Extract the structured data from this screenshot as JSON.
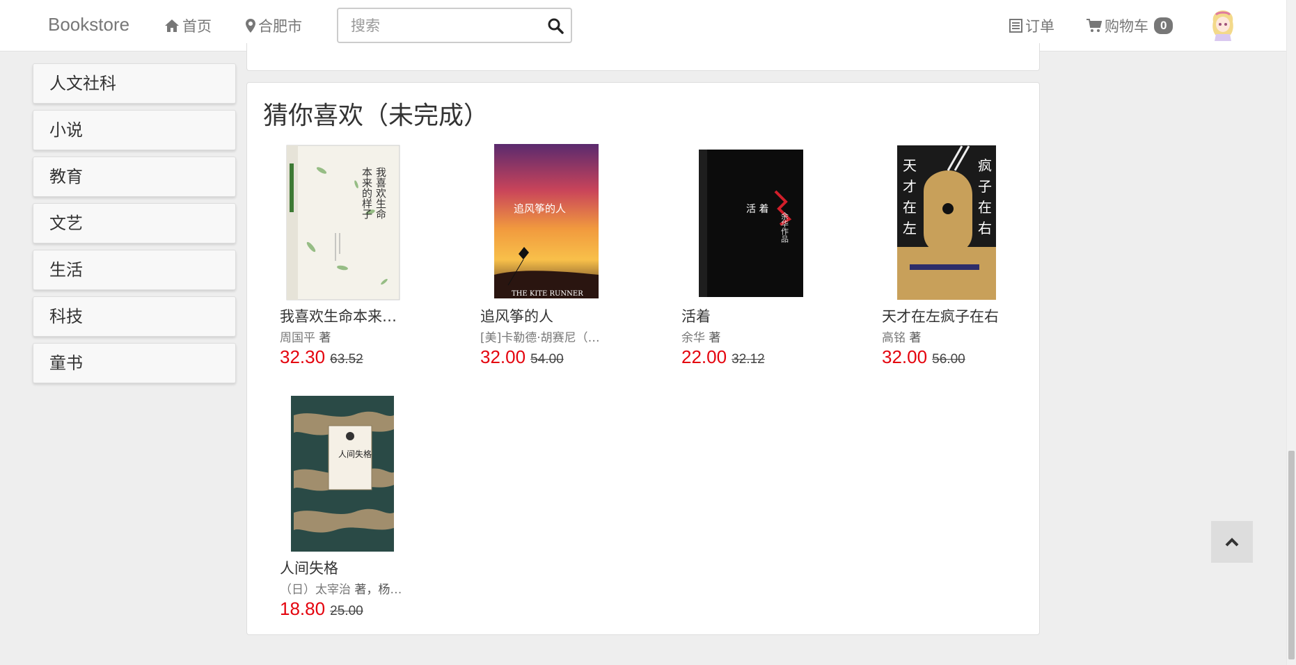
{
  "navbar": {
    "brand": "Bookstore",
    "home_label": "首页",
    "location_label": "合肥市",
    "search_placeholder": "搜索",
    "orders_label": "订单",
    "cart_label": "购物车",
    "cart_count": "0"
  },
  "sidebar": {
    "items": [
      {
        "label": "人文社科"
      },
      {
        "label": "小说"
      },
      {
        "label": "教育"
      },
      {
        "label": "文艺"
      },
      {
        "label": "生活"
      },
      {
        "label": "科技"
      },
      {
        "label": "童书"
      }
    ]
  },
  "recommend": {
    "title": "猜你喜欢（未完成）",
    "books": [
      {
        "title": "我喜欢生命本来的样子",
        "author": "周国平",
        "author_suffix": "著",
        "price": "32.30",
        "old_price": "63.52",
        "cover_text": "我喜欢生命本来的样子"
      },
      {
        "title": "追风筝的人",
        "author": "[美]卡勒德·胡赛尼（Khaled Hosseini）",
        "author_suffix": "",
        "price": "32.00",
        "old_price": "54.00",
        "cover_text": "追风筝的人",
        "cover_sub": "THE KITE RUNNER"
      },
      {
        "title": "活着",
        "author": "余华",
        "author_suffix": "著",
        "price": "22.00",
        "old_price": "32.12",
        "cover_text": "活着",
        "cover_sub": "余华作品"
      },
      {
        "title": "天才在左疯子在右",
        "author": "高铭",
        "author_suffix": "著",
        "price": "32.00",
        "old_price": "56.00",
        "cover_text": "天才在左疯子在右"
      },
      {
        "title": "人间失格",
        "author": "（日）太宰治",
        "author_suffix": "著，杨伟译",
        "price": "18.80",
        "old_price": "25.00",
        "cover_text": "人间失格"
      }
    ]
  },
  "colors": {
    "price": "#e4040e",
    "brand": "#777777",
    "background": "#eeeeee"
  },
  "icons": [
    "home-icon",
    "map-marker-icon",
    "search-icon",
    "list-icon",
    "shopping-cart-icon",
    "chevron-up-icon"
  ]
}
